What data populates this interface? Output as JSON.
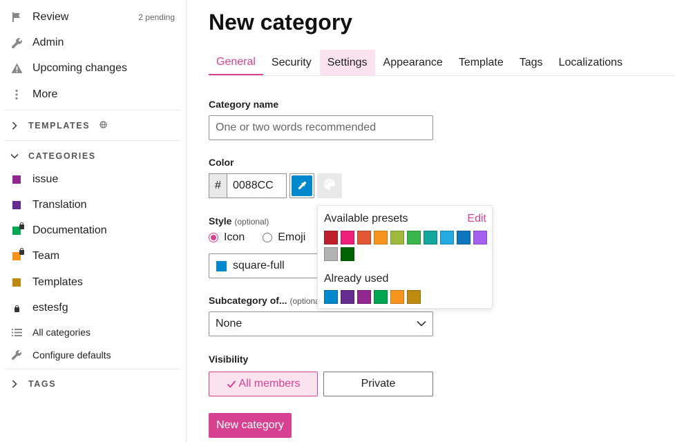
{
  "sidebar": {
    "review": {
      "label": "Review",
      "badge": "2 pending"
    },
    "admin": {
      "label": "Admin"
    },
    "upcoming": {
      "label": "Upcoming changes"
    },
    "more": {
      "label": "More"
    },
    "templates_section": "TEMPLATES",
    "categories_section": "CATEGORIES",
    "categories": [
      {
        "label": "issue",
        "color": "#92278f"
      },
      {
        "label": "Translation",
        "color": "#652d90"
      },
      {
        "label": "Documentation",
        "color": "#00a651"
      },
      {
        "label": "Team",
        "color": "#f7941d"
      },
      {
        "label": "Templates",
        "color": "#bf8b0f"
      },
      {
        "label": "estesfg",
        "color": ""
      }
    ],
    "all_categories": "All categories",
    "configure_defaults": "Configure defaults",
    "tags_section": "TAGS"
  },
  "page": {
    "title": "New category",
    "tabs": [
      "General",
      "Security",
      "Settings",
      "Appearance",
      "Template",
      "Tags",
      "Localizations"
    ],
    "active_tab": "General",
    "hover_tab": "Settings"
  },
  "form": {
    "name_label": "Category name",
    "name_placeholder": "One or two words recommended",
    "name_value": "",
    "color_label": "Color",
    "hash": "#",
    "color_value": "0088CC",
    "style_label": "Style",
    "optional": "(optional)",
    "style_icon": "Icon",
    "style_emoji": "Emoji",
    "icon_value": "square-full",
    "subcategory_label": "Subcategory of...",
    "subcategory_optional": "(optional)",
    "subcategory_value": "None",
    "visibility_label": "Visibility",
    "visibility_all": "All members",
    "visibility_private": "Private",
    "submit": "New category"
  },
  "popover": {
    "presets_title": "Available presets",
    "edit": "Edit",
    "presets": [
      "#bf1e2e",
      "#ed207b",
      "#e45735",
      "#f7941d",
      "#9eb83b",
      "#3ab54a",
      "#12a89d",
      "#25aae2",
      "#0e76bd",
      "#a461ef",
      "#b3b3b3",
      "#006400"
    ],
    "used_title": "Already used",
    "used": [
      "#0088cc",
      "#652d90",
      "#92278f",
      "#00a651",
      "#f7941d",
      "#bf8b0f"
    ]
  },
  "colors": {
    "accent": "#d6428f",
    "accent_bg": "#fae3ef",
    "selected_color": "#0088cc"
  }
}
